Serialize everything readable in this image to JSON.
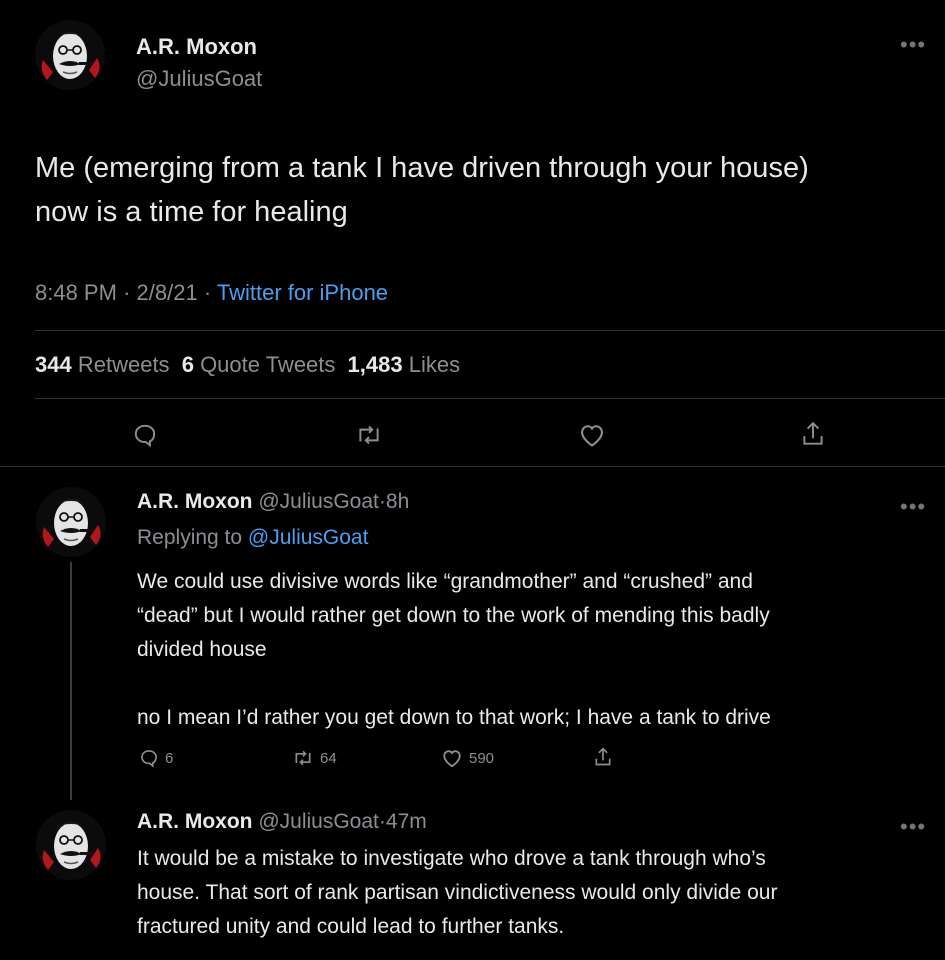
{
  "main_tweet": {
    "author_name": "A.R. Moxon",
    "author_handle": "@JuliusGoat",
    "text_line1": "Me (emerging from a tank I have driven through your house)",
    "text_line2": "now is a time for healing",
    "time": "8:48 PM",
    "date": "2/8/21",
    "source": "Twitter for iPhone",
    "separator": "·",
    "retweets_count": "344",
    "retweets_label": "Retweets",
    "quotes_count": "6",
    "quotes_label": "Quote Tweets",
    "likes_count": "1,483",
    "likes_label": "Likes"
  },
  "reply1": {
    "author_name": "A.R. Moxon",
    "author_handle": "@JuliusGoat",
    "age": "8h",
    "separator": "·",
    "replying_prefix": "Replying to",
    "replying_handle": "@JuliusGoat",
    "line1": "We could use divisive words like “grandmother” and “crushed” and",
    "line2": "“dead” but I would rather get down to the work of mending this badly",
    "line3": "divided house",
    "line4": "no I mean I’d rather you get down to that work; I have a tank to drive",
    "reply_count": "6",
    "retweet_count": "64",
    "like_count": "590"
  },
  "reply2": {
    "author_name": "A.R. Moxon",
    "author_handle": "@JuliusGoat",
    "age": "47m",
    "separator": "·",
    "line1": "It would be a mistake to investigate who drove a tank through who’s",
    "line2": "house. That sort of rank partisan vindictiveness would only divide our",
    "line3": "fractured unity and could lead to further tanks."
  },
  "icons": {
    "more": "more-horizontal-icon",
    "reply": "reply-bubble-icon",
    "retweet": "retweet-icon",
    "like": "heart-icon",
    "share": "share-icon"
  },
  "colors": {
    "background": "#000000",
    "text": "#e7e9ea",
    "muted": "#8b8f94",
    "link": "#4a9ff0",
    "divider": "#2f3336"
  }
}
